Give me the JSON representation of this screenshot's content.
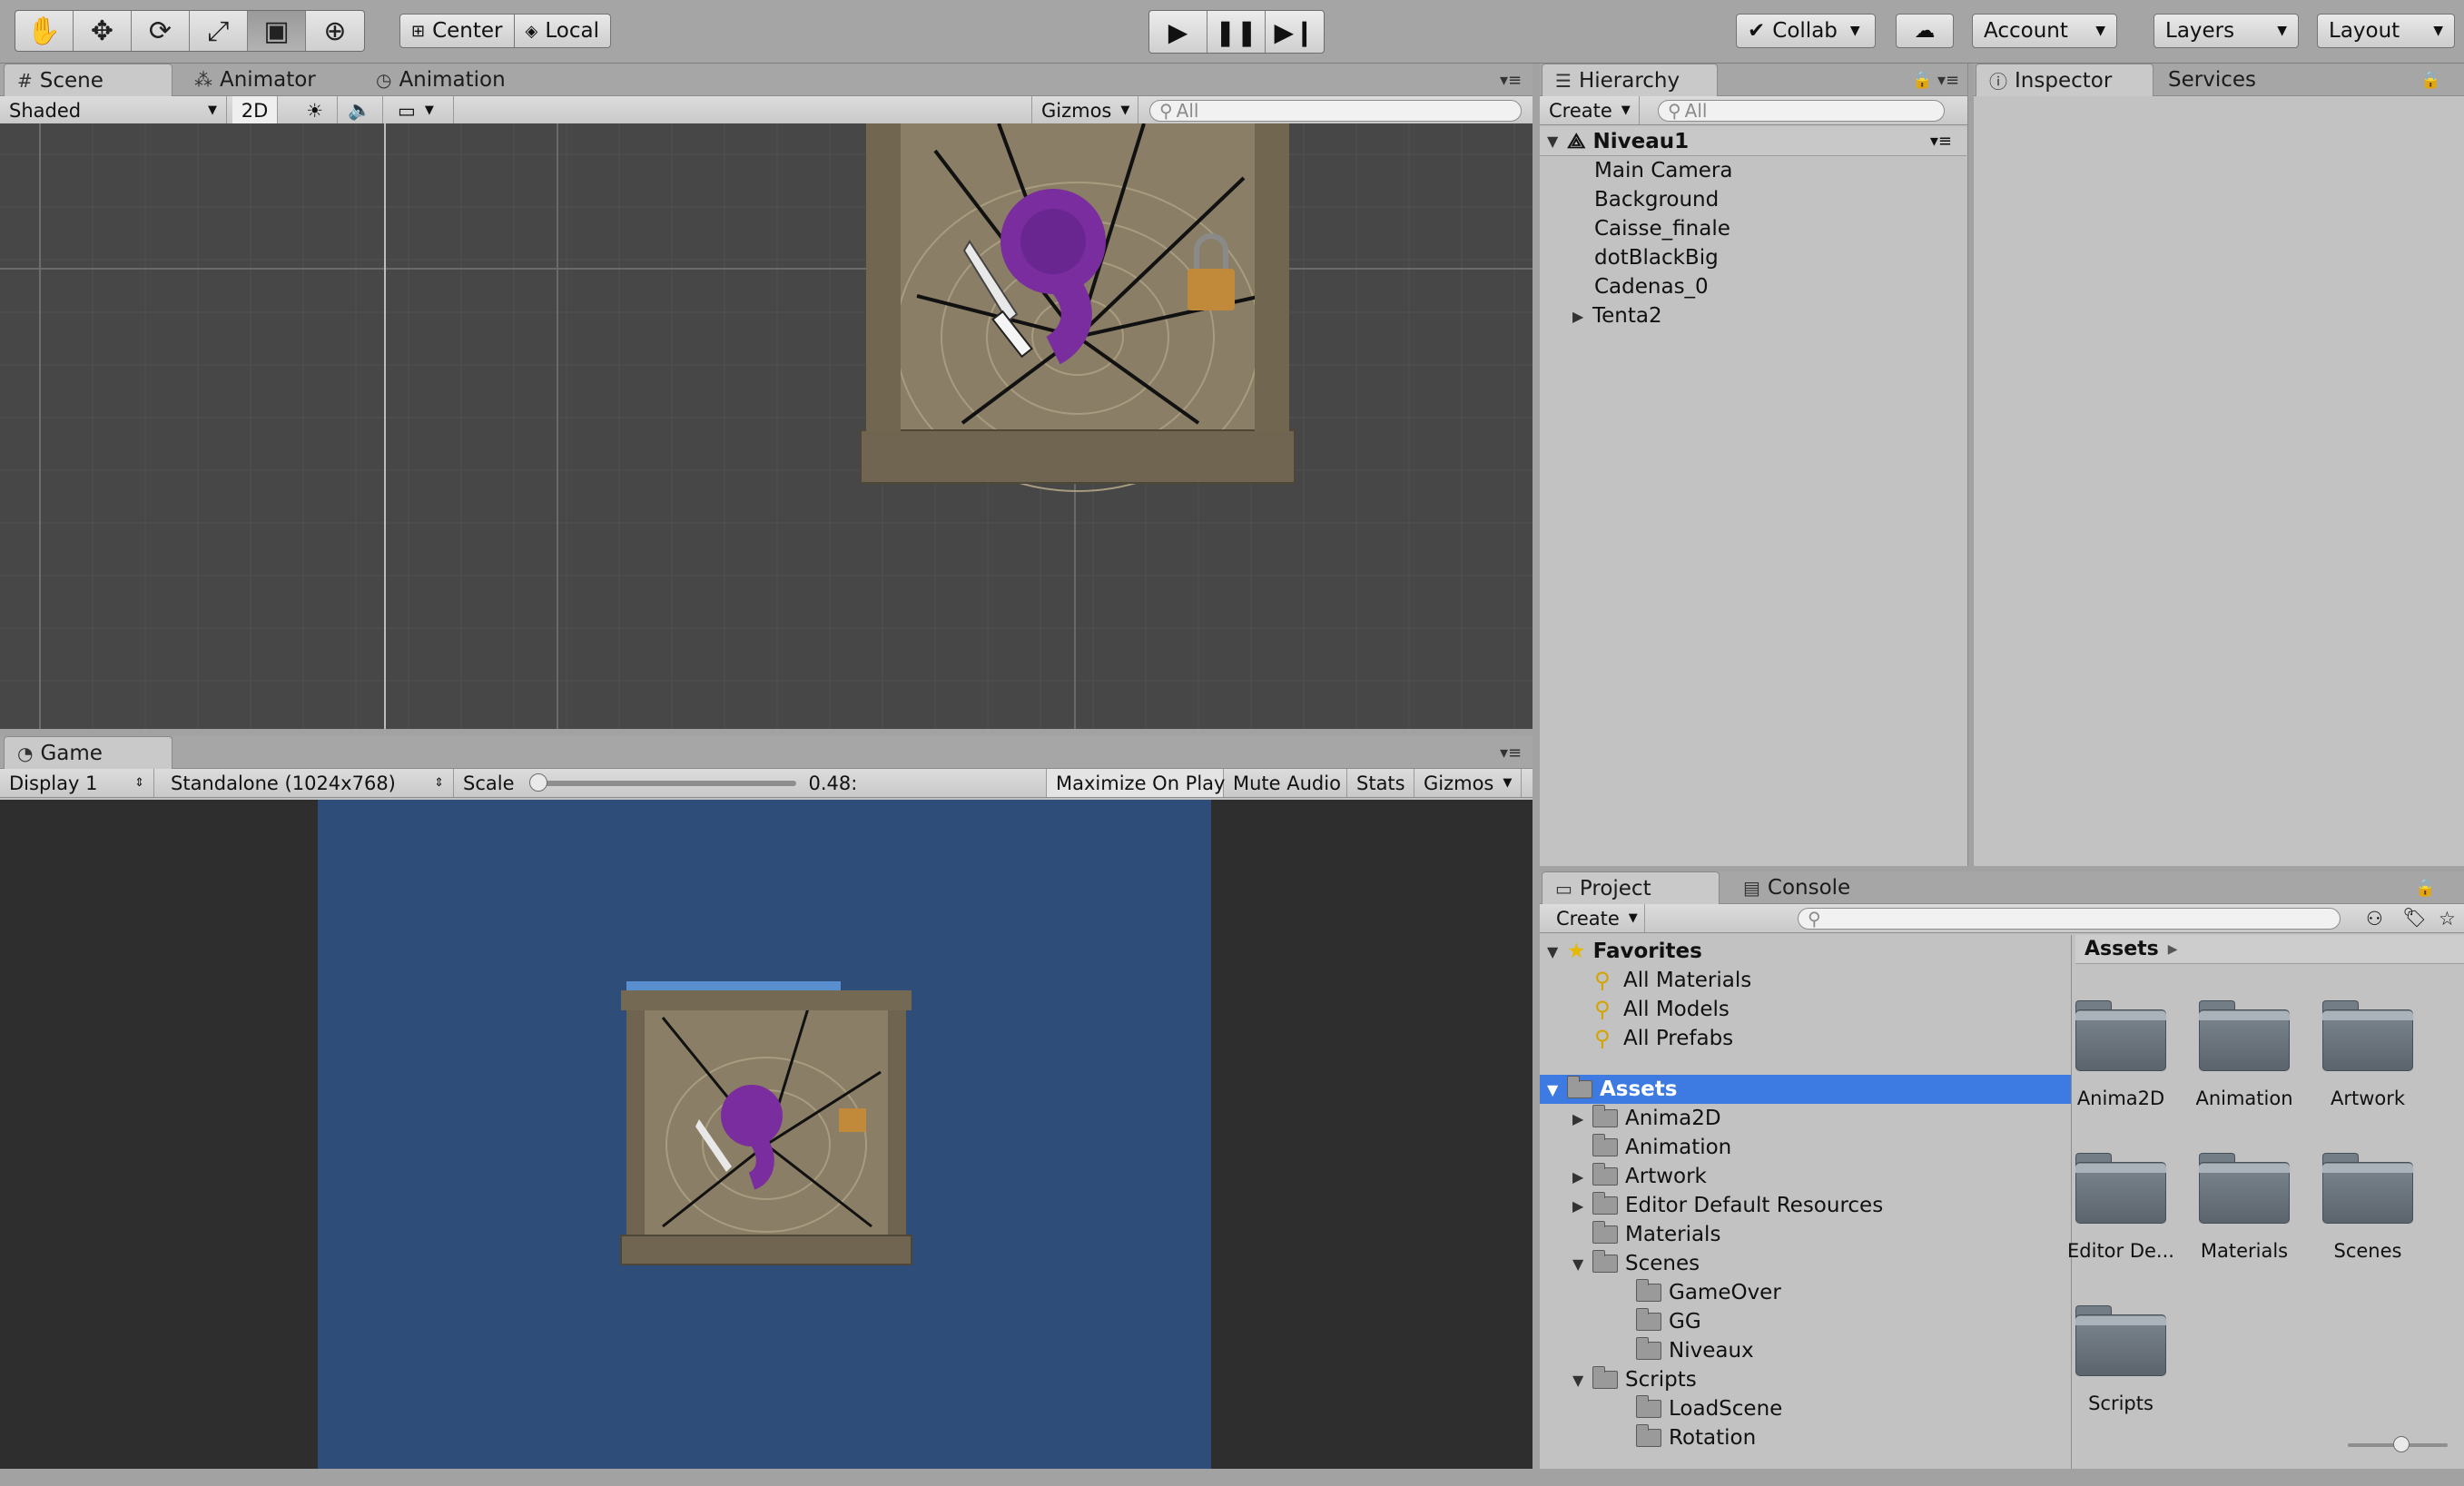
{
  "toolbar": {
    "transform_tools": [
      "hand-icon",
      "move-icon",
      "rotate-icon",
      "scale-icon",
      "rect-icon",
      "transform-icon"
    ],
    "pivot_center": "Center",
    "pivot_local": "Local",
    "play_controls": [
      "play-icon",
      "pause-icon",
      "step-icon"
    ],
    "collab": "Collab",
    "account": "Account",
    "layers": "Layers",
    "layout": "Layout"
  },
  "scene": {
    "tabs": [
      "Scene",
      "Animator",
      "Animation"
    ],
    "shading": "Shaded",
    "mode_2d": "2D",
    "gizmos": "Gizmos",
    "search_placeholder": "All"
  },
  "game": {
    "tab": "Game",
    "display": "Display 1",
    "resolution": "Standalone (1024x768)",
    "scale_label": "Scale",
    "scale_value": "0.48:",
    "maximize": "Maximize On Play",
    "mute": "Mute Audio",
    "stats": "Stats",
    "gizmos": "Gizmos"
  },
  "hierarchy": {
    "tab": "Hierarchy",
    "create": "Create",
    "search_placeholder": "All",
    "scene_name": "Niveau1",
    "items": [
      "Main Camera",
      "Background",
      "Caisse_finale",
      "dotBlackBig",
      "Cadenas_0",
      "Tenta2"
    ]
  },
  "inspector": {
    "tab": "Inspector",
    "services_tab": "Services"
  },
  "project": {
    "tab": "Project",
    "console_tab": "Console",
    "create": "Create",
    "favorites_label": "Favorites",
    "favorites": [
      "All Materials",
      "All Models",
      "All Prefabs"
    ],
    "assets_label": "Assets",
    "tree": [
      {
        "label": "Anima2D",
        "level": 1,
        "expand": "closed"
      },
      {
        "label": "Animation",
        "level": 1,
        "expand": "none"
      },
      {
        "label": "Artwork",
        "level": 1,
        "expand": "closed"
      },
      {
        "label": "Editor Default Resources",
        "level": 1,
        "expand": "closed"
      },
      {
        "label": "Materials",
        "level": 1,
        "expand": "none"
      },
      {
        "label": "Scenes",
        "level": 1,
        "expand": "open"
      },
      {
        "label": "GameOver",
        "level": 2,
        "expand": "none"
      },
      {
        "label": "GG",
        "level": 2,
        "expand": "none"
      },
      {
        "label": "Niveaux",
        "level": 2,
        "expand": "none"
      },
      {
        "label": "Scripts",
        "level": 1,
        "expand": "open"
      },
      {
        "label": "LoadScene",
        "level": 2,
        "expand": "none"
      },
      {
        "label": "Rotation",
        "level": 2,
        "expand": "none"
      }
    ],
    "breadcrumb": "Assets",
    "grid_items": [
      "Anima2D",
      "Animation",
      "Artwork",
      "Editor De...",
      "Materials",
      "Scenes",
      "Scripts"
    ]
  }
}
